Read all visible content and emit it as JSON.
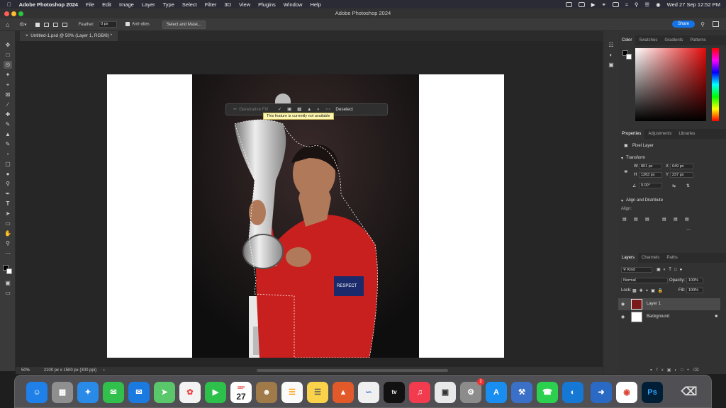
{
  "menubar": {
    "app_name": "Adobe Photoshop 2024",
    "items": [
      "File",
      "Edit",
      "Image",
      "Layer",
      "Type",
      "Select",
      "Filter",
      "3D",
      "View",
      "Plugins",
      "Window",
      "Help"
    ],
    "clock": "Wed 27 Sep  12:52 PM"
  },
  "window": {
    "title": "Adobe Photoshop 2024"
  },
  "options": {
    "feather_label": "Feather:",
    "feather_value": "0 px",
    "antialias_label": "Anti-alias",
    "select_mask_label": "Select and Mask...",
    "share_label": "Share"
  },
  "document": {
    "tab_title": "Untitled-1.psd @ 50% (Layer 1, RGB/8) *"
  },
  "context_bar": {
    "generative_fill": "Generative Fill",
    "deselect": "Deselect",
    "tooltip": "This feature is currently not available"
  },
  "status": {
    "zoom": "50%",
    "doc_size": "2100 px x 1500 px (300 ppi)"
  },
  "panels": {
    "color_tabs": [
      "Color",
      "Swatches",
      "Gradients",
      "Patterns"
    ],
    "props_tabs": [
      "Properties",
      "Adjustments",
      "Libraries"
    ],
    "pixel_layer": "Pixel Layer",
    "transform": "Transform",
    "w_label": "W",
    "w_value": "801 px",
    "x_label": "X",
    "x_value": "649 px",
    "h_label": "H",
    "h_value": "1263 px",
    "y_label": "Y",
    "y_value": "237 px",
    "angle": "0.00°",
    "align_heading": "Align and Distribute",
    "align_label": "Align:",
    "layers_tabs": [
      "Layers",
      "Channels",
      "Paths"
    ],
    "kind": "Kind",
    "blend_mode": "Normal",
    "opacity_label": "Opacity:",
    "opacity_value": "100%",
    "lock_label": "Lock:",
    "fill_label": "Fill:",
    "fill_value": "100%",
    "layers": [
      "Layer 1",
      "Background"
    ]
  },
  "dock": {
    "calendar_month": "SEP",
    "calendar_day": "27",
    "settings_badge": "2",
    "tv_label": "tv",
    "ps_label": "Ps"
  },
  "colors": {
    "accent": "#1473e6",
    "panel": "#323232",
    "canvas": "#262626"
  }
}
